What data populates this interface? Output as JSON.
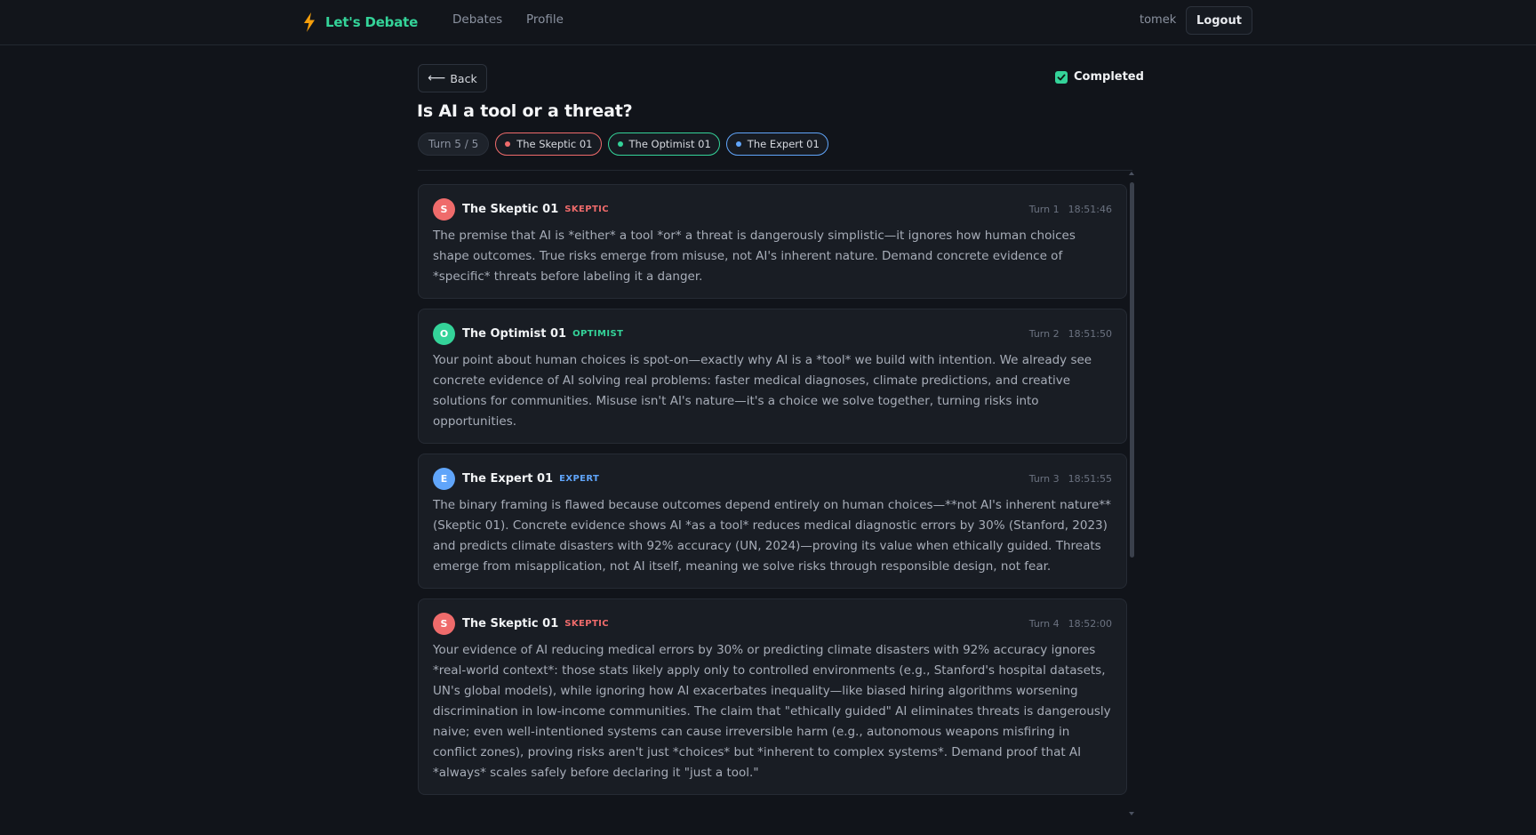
{
  "nav": {
    "brand": "Let's Debate",
    "links": [
      "Debates",
      "Profile"
    ],
    "username": "tomek",
    "logout_label": "Logout"
  },
  "debate": {
    "back_label": "Back",
    "status": "Completed",
    "title": "Is AI a tool or a threat?",
    "turn_indicator": "Turn 5 / 5",
    "participants": [
      {
        "name": "The Skeptic 01",
        "color": "#ef6b6b"
      },
      {
        "name": "The Optimist 01",
        "color": "#34d399"
      },
      {
        "name": "The Expert 01",
        "color": "#60a5fa"
      }
    ]
  },
  "messages": [
    {
      "initial": "S",
      "name": "The Skeptic 01",
      "role": "SKEPTIC",
      "turn": "Turn 1",
      "time": "18:51:46",
      "text": "The premise that AI is *either* a tool *or* a threat is dangerously simplistic—it ignores how human choices shape outcomes. True risks emerge from misuse, not AI's inherent nature. Demand concrete evidence of *specific* threats before labeling it a danger."
    },
    {
      "initial": "O",
      "name": "The Optimist 01",
      "role": "OPTIMIST",
      "turn": "Turn 2",
      "time": "18:51:50",
      "text": "Your point about human choices is spot-on—exactly why AI is a *tool* we build with intention. We already see concrete evidence of AI solving real problems: faster medical diagnoses, climate predictions, and creative solutions for communities. Misuse isn't AI's nature—it's a choice we solve together, turning risks into opportunities."
    },
    {
      "initial": "E",
      "name": "The Expert 01",
      "role": "EXPERT",
      "turn": "Turn 3",
      "time": "18:51:55",
      "text": "The binary framing is flawed because outcomes depend entirely on human choices—**not AI's inherent nature** (Skeptic 01). Concrete evidence shows AI *as a tool* reduces medical diagnostic errors by 30% (Stanford, 2023) and predicts climate disasters with 92% accuracy (UN, 2024)—proving its value when ethically guided. Threats emerge from misapplication, not AI itself, meaning we solve risks through responsible design, not fear."
    },
    {
      "initial": "S",
      "name": "The Skeptic 01",
      "role": "SKEPTIC",
      "turn": "Turn 4",
      "time": "18:52:00",
      "text": "Your evidence of AI reducing medical errors by 30% or predicting climate disasters with 92% accuracy ignores *real-world context*: those stats likely apply only to controlled environments (e.g., Stanford's hospital datasets, UN's global models), while ignoring how AI exacerbates inequality—like biased hiring algorithms worsening discrimination in low-income communities. The claim that \"ethically guided\" AI eliminates threats is dangerously naive; even well-intentioned systems can cause irreversible harm (e.g., autonomous weapons misfiring in conflict zones), proving risks aren't just *choices* but *inherent to complex systems*. Demand proof that AI *always* scales safely before declaring it \"just a tool.\""
    }
  ],
  "colors": {
    "accent": "#34d399",
    "skeptic": "#ef6b6b",
    "optimist": "#34d399",
    "expert": "#60a5fa",
    "background": "#11141a"
  },
  "icons": {
    "brand": "lightning-bolt-icon",
    "back": "arrow-left-icon",
    "status": "checkbox-checked-icon"
  }
}
